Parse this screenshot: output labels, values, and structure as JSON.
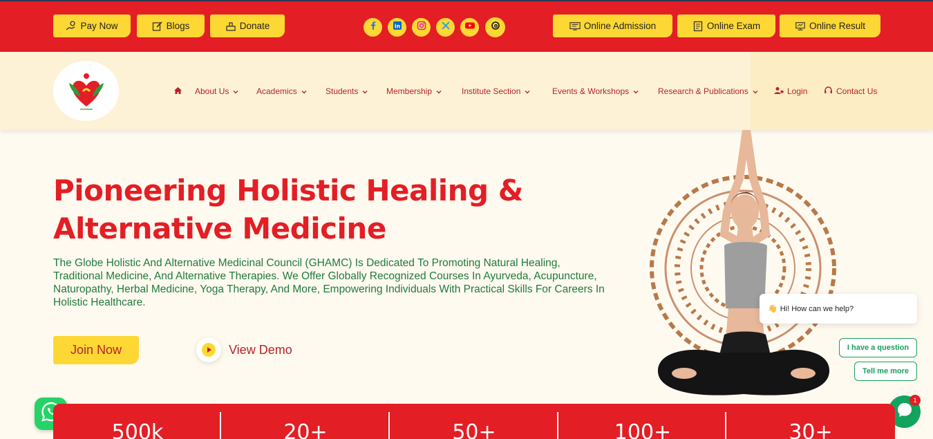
{
  "topbar": {
    "left_buttons": [
      {
        "label": "Pay Now",
        "icon": "hand-money-icon"
      },
      {
        "label": "Blogs",
        "icon": "edit-icon"
      },
      {
        "label": "Donate",
        "icon": "donate-icon"
      }
    ],
    "socials": [
      "facebook-icon",
      "linkedin-icon",
      "instagram-icon",
      "x-icon",
      "youtube-icon",
      "threads-icon"
    ],
    "right_buttons": [
      {
        "label": "Online Admission",
        "icon": "admission-icon"
      },
      {
        "label": "Online Exam",
        "icon": "exam-icon"
      },
      {
        "label": "Online Result",
        "icon": "result-icon"
      }
    ]
  },
  "nav": {
    "items": [
      {
        "label": "About Us"
      },
      {
        "label": "Academics"
      },
      {
        "label": "Students"
      },
      {
        "label": "Membership"
      },
      {
        "label": "Institute Section"
      },
      {
        "label": "Events & Workshops"
      },
      {
        "label": "Research & Publications"
      }
    ],
    "login": "Login",
    "contact": "Contact Us"
  },
  "hero": {
    "title_line1": "Pioneering Holistic Healing &",
    "title_line2": "Alternative Medicine",
    "description": "The Globe Holistic And Alternative Medicinal Council (GHAMC) Is Dedicated To Promoting Natural Healing, Traditional Medicine, And Alternative Therapies. We Offer Globally Recognized Courses In Ayurveda, Acupuncture, Naturopathy, Herbal Medicine, Yoga Therapy, And More, Empowering Individuals With Practical Skills For Careers In Holistic Healthcare.",
    "join_label": "Join Now",
    "demo_label": "View Demo"
  },
  "chat": {
    "greeting": "Hi! How can we help?",
    "option1": "I have a question",
    "option2": "Tell me more",
    "badge": "1"
  },
  "stats": [
    "500k",
    "20+",
    "50+",
    "100+",
    "30+"
  ],
  "colors": {
    "brand_red": "#e31e25",
    "accent_yellow": "#fdd835",
    "text_green": "#1f7a3a"
  }
}
